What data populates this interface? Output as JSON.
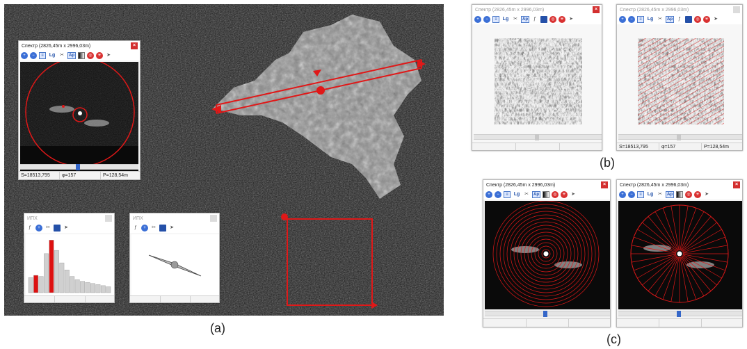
{
  "spectrum_window": {
    "title": "Спектр (2826,45m x 2996,03m)",
    "close": "×",
    "status": {
      "s": "S=18513,795",
      "phi": "φ=157",
      "p": "P=128,54m"
    }
  },
  "toolbar": {
    "text_lg": "Lg",
    "text_ap": "Ap"
  },
  "hist_window": {
    "title": "ИПХ"
  },
  "polar_window": {
    "title": "ИПХ"
  },
  "histogram": {
    "values": [
      0.28,
      0.32,
      0.3,
      0.72,
      0.97,
      0.78,
      0.55,
      0.42,
      0.3,
      0.24,
      0.21,
      0.19,
      0.17,
      0.15,
      0.13,
      0.11
    ],
    "highlighted": [
      1,
      4
    ],
    "bar_color": "#d0d0d0",
    "highlight_color": "#dd1010"
  },
  "labels": {
    "a": "(a)",
    "b": "(b)",
    "c": "(c)"
  },
  "colors": {
    "accent": "#e01818",
    "slider": "#3466c8"
  }
}
